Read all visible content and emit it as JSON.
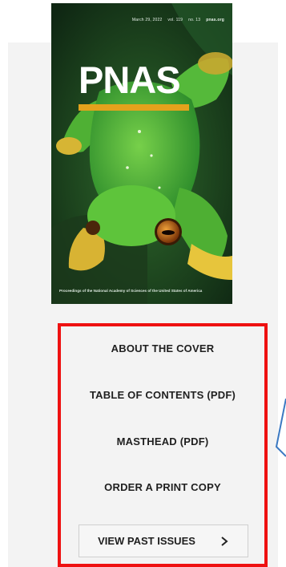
{
  "cover": {
    "date": "March 29, 2022",
    "volume": "vol. 119",
    "number": "no. 13",
    "site": "pnas.org",
    "title": "PNAS",
    "footer": "Proceedings of the National Academy of Sciences of the United States of America"
  },
  "links": [
    {
      "label": "ABOUT THE COVER"
    },
    {
      "label": "TABLE OF CONTENTS (PDF)"
    },
    {
      "label": "MASTHEAD (PDF)"
    },
    {
      "label": "ORDER A PRINT COPY"
    }
  ],
  "past_issues": {
    "label": "VIEW PAST ISSUES",
    "icon": "chevron-right-icon"
  },
  "colors": {
    "highlight": "#ee1111",
    "panel": "#f3f3f3",
    "accent_bar": "#e4a21c",
    "annotation_arrow": "#3b79c2"
  }
}
